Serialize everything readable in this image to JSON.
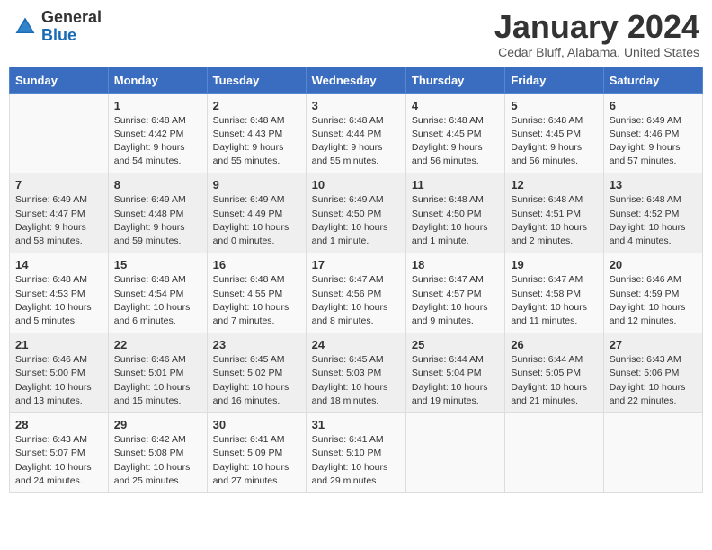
{
  "header": {
    "logo_general": "General",
    "logo_blue": "Blue",
    "title": "January 2024",
    "location": "Cedar Bluff, Alabama, United States"
  },
  "days_of_week": [
    "Sunday",
    "Monday",
    "Tuesday",
    "Wednesday",
    "Thursday",
    "Friday",
    "Saturday"
  ],
  "weeks": [
    [
      {
        "day": "",
        "info": ""
      },
      {
        "day": "1",
        "info": "Sunrise: 6:48 AM\nSunset: 4:42 PM\nDaylight: 9 hours\nand 54 minutes."
      },
      {
        "day": "2",
        "info": "Sunrise: 6:48 AM\nSunset: 4:43 PM\nDaylight: 9 hours\nand 55 minutes."
      },
      {
        "day": "3",
        "info": "Sunrise: 6:48 AM\nSunset: 4:44 PM\nDaylight: 9 hours\nand 55 minutes."
      },
      {
        "day": "4",
        "info": "Sunrise: 6:48 AM\nSunset: 4:45 PM\nDaylight: 9 hours\nand 56 minutes."
      },
      {
        "day": "5",
        "info": "Sunrise: 6:48 AM\nSunset: 4:45 PM\nDaylight: 9 hours\nand 56 minutes."
      },
      {
        "day": "6",
        "info": "Sunrise: 6:49 AM\nSunset: 4:46 PM\nDaylight: 9 hours\nand 57 minutes."
      }
    ],
    [
      {
        "day": "7",
        "info": "Sunrise: 6:49 AM\nSunset: 4:47 PM\nDaylight: 9 hours\nand 58 minutes."
      },
      {
        "day": "8",
        "info": "Sunrise: 6:49 AM\nSunset: 4:48 PM\nDaylight: 9 hours\nand 59 minutes."
      },
      {
        "day": "9",
        "info": "Sunrise: 6:49 AM\nSunset: 4:49 PM\nDaylight: 10 hours\nand 0 minutes."
      },
      {
        "day": "10",
        "info": "Sunrise: 6:49 AM\nSunset: 4:50 PM\nDaylight: 10 hours\nand 1 minute."
      },
      {
        "day": "11",
        "info": "Sunrise: 6:48 AM\nSunset: 4:50 PM\nDaylight: 10 hours\nand 1 minute."
      },
      {
        "day": "12",
        "info": "Sunrise: 6:48 AM\nSunset: 4:51 PM\nDaylight: 10 hours\nand 2 minutes."
      },
      {
        "day": "13",
        "info": "Sunrise: 6:48 AM\nSunset: 4:52 PM\nDaylight: 10 hours\nand 4 minutes."
      }
    ],
    [
      {
        "day": "14",
        "info": "Sunrise: 6:48 AM\nSunset: 4:53 PM\nDaylight: 10 hours\nand 5 minutes."
      },
      {
        "day": "15",
        "info": "Sunrise: 6:48 AM\nSunset: 4:54 PM\nDaylight: 10 hours\nand 6 minutes."
      },
      {
        "day": "16",
        "info": "Sunrise: 6:48 AM\nSunset: 4:55 PM\nDaylight: 10 hours\nand 7 minutes."
      },
      {
        "day": "17",
        "info": "Sunrise: 6:47 AM\nSunset: 4:56 PM\nDaylight: 10 hours\nand 8 minutes."
      },
      {
        "day": "18",
        "info": "Sunrise: 6:47 AM\nSunset: 4:57 PM\nDaylight: 10 hours\nand 9 minutes."
      },
      {
        "day": "19",
        "info": "Sunrise: 6:47 AM\nSunset: 4:58 PM\nDaylight: 10 hours\nand 11 minutes."
      },
      {
        "day": "20",
        "info": "Sunrise: 6:46 AM\nSunset: 4:59 PM\nDaylight: 10 hours\nand 12 minutes."
      }
    ],
    [
      {
        "day": "21",
        "info": "Sunrise: 6:46 AM\nSunset: 5:00 PM\nDaylight: 10 hours\nand 13 minutes."
      },
      {
        "day": "22",
        "info": "Sunrise: 6:46 AM\nSunset: 5:01 PM\nDaylight: 10 hours\nand 15 minutes."
      },
      {
        "day": "23",
        "info": "Sunrise: 6:45 AM\nSunset: 5:02 PM\nDaylight: 10 hours\nand 16 minutes."
      },
      {
        "day": "24",
        "info": "Sunrise: 6:45 AM\nSunset: 5:03 PM\nDaylight: 10 hours\nand 18 minutes."
      },
      {
        "day": "25",
        "info": "Sunrise: 6:44 AM\nSunset: 5:04 PM\nDaylight: 10 hours\nand 19 minutes."
      },
      {
        "day": "26",
        "info": "Sunrise: 6:44 AM\nSunset: 5:05 PM\nDaylight: 10 hours\nand 21 minutes."
      },
      {
        "day": "27",
        "info": "Sunrise: 6:43 AM\nSunset: 5:06 PM\nDaylight: 10 hours\nand 22 minutes."
      }
    ],
    [
      {
        "day": "28",
        "info": "Sunrise: 6:43 AM\nSunset: 5:07 PM\nDaylight: 10 hours\nand 24 minutes."
      },
      {
        "day": "29",
        "info": "Sunrise: 6:42 AM\nSunset: 5:08 PM\nDaylight: 10 hours\nand 25 minutes."
      },
      {
        "day": "30",
        "info": "Sunrise: 6:41 AM\nSunset: 5:09 PM\nDaylight: 10 hours\nand 27 minutes."
      },
      {
        "day": "31",
        "info": "Sunrise: 6:41 AM\nSunset: 5:10 PM\nDaylight: 10 hours\nand 29 minutes."
      },
      {
        "day": "",
        "info": ""
      },
      {
        "day": "",
        "info": ""
      },
      {
        "day": "",
        "info": ""
      }
    ]
  ]
}
